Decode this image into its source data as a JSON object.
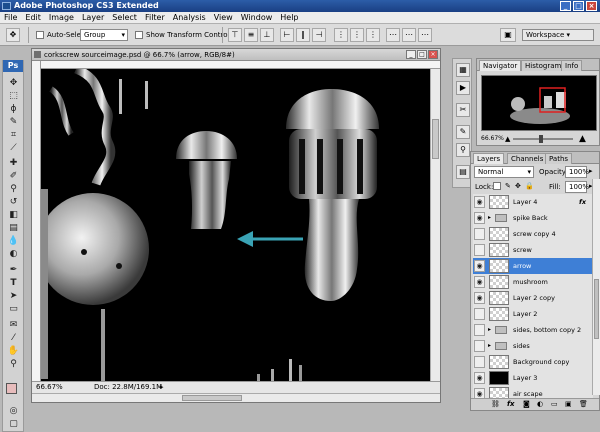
{
  "app": {
    "title": "Adobe Photoshop CS3 Extended",
    "logo": "Ps",
    "window_controls": [
      "_",
      "□",
      "×"
    ]
  },
  "menu": [
    "File",
    "Edit",
    "Image",
    "Layer",
    "Select",
    "Filter",
    "Analysis",
    "View",
    "Window",
    "Help"
  ],
  "options_bar": {
    "auto_select_label": "Auto-Select:",
    "auto_select_value": "Group",
    "show_transform_label": "Show Transform Controls",
    "workspace_label": "Workspace ▾"
  },
  "document": {
    "title": "corkscrew sourceimage.psd @ 66.7% (arrow, RGB/8#)",
    "zoom": "66.67%",
    "doc_size": "Doc: 22.8M/169.1M"
  },
  "navigator": {
    "tabs": [
      "Navigator",
      "Histogram",
      "Info"
    ],
    "zoom": "66.67%"
  },
  "layers_panel": {
    "tabs": [
      "Layers",
      "Channels",
      "Paths"
    ],
    "blend_mode": "Normal",
    "opacity_label": "Opacity:",
    "opacity_value": "100%",
    "lock_label": "Lock:",
    "fill_label": "Fill:",
    "fill_value": "100%",
    "fx_label": "fx",
    "layers": [
      {
        "name": "Layer 4",
        "visible": true,
        "type": "layer",
        "selected": false
      },
      {
        "name": "spike Back",
        "visible": true,
        "type": "group",
        "selected": false
      },
      {
        "name": "screw copy 4",
        "visible": false,
        "type": "layer",
        "selected": false
      },
      {
        "name": "screw",
        "visible": false,
        "type": "layer",
        "selected": false
      },
      {
        "name": "arrow",
        "visible": true,
        "type": "layer",
        "selected": true
      },
      {
        "name": "mushroom",
        "visible": true,
        "type": "layer",
        "selected": false
      },
      {
        "name": "Layer 2 copy",
        "visible": true,
        "type": "layer",
        "selected": false
      },
      {
        "name": "Layer 2",
        "visible": false,
        "type": "layer",
        "selected": false
      },
      {
        "name": "sides, bottom copy 2",
        "visible": false,
        "type": "group",
        "selected": false
      },
      {
        "name": "sides",
        "visible": false,
        "type": "group",
        "selected": false
      },
      {
        "name": "Background copy",
        "visible": false,
        "type": "layer",
        "selected": false
      },
      {
        "name": "Layer 3",
        "visible": true,
        "type": "layer",
        "selected": false
      },
      {
        "name": "air scape",
        "visible": true,
        "type": "layer",
        "selected": false
      }
    ]
  },
  "colors": {
    "arrow": "#3aa3b5",
    "selection": "#3e7fd6",
    "foreground_swatch": "#e7bcbc",
    "background_swatch": "#000000"
  }
}
